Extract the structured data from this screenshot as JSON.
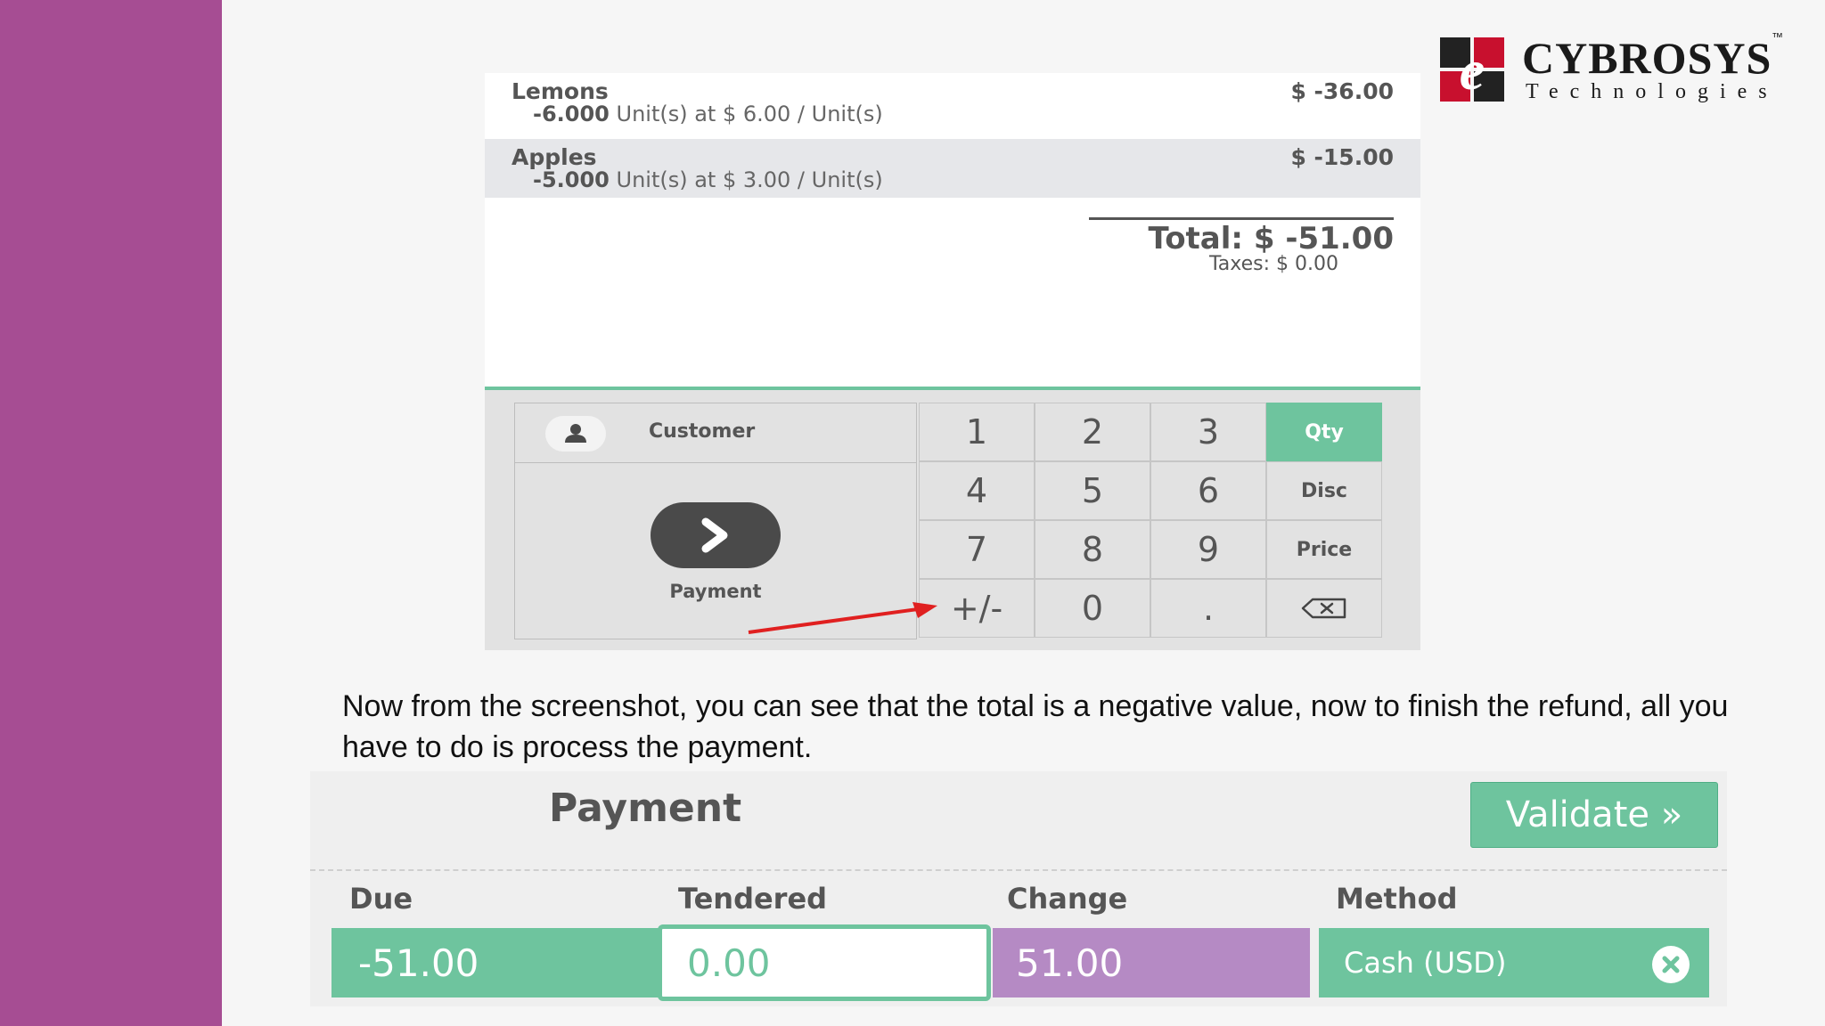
{
  "logo": {
    "name": "CYBROSYS",
    "tm": "™",
    "sub": "Technologies"
  },
  "order": {
    "lines": [
      {
        "product": "Lemons",
        "qty": "-6.000",
        "detail": " Unit(s) at $ 6.00 / Unit(s)",
        "price": "$ -36.00"
      },
      {
        "product": "Apples",
        "qty": "-5.000",
        "detail": " Unit(s) at $ 3.00 / Unit(s)",
        "price": "$ -15.00"
      }
    ],
    "total": "Total: $ -51.00",
    "taxes": "Taxes: $ 0.00"
  },
  "controls": {
    "customer_label": "Customer",
    "payment_label": "Payment",
    "numpad": [
      "1",
      "2",
      "3",
      "Qty",
      "4",
      "5",
      "6",
      "Disc",
      "7",
      "8",
      "9",
      "Price",
      "+/-",
      "0",
      "."
    ],
    "active_mode": "Qty"
  },
  "paragraph": "Now from the screenshot, you can see that the total is a negative value, now to finish the refund, all you have to do is process the payment.",
  "payment_screen": {
    "title": "Payment",
    "validate_label": "Validate »",
    "headers": {
      "due": "Due",
      "tendered": "Tendered",
      "change": "Change",
      "method": "Method"
    },
    "values": {
      "due": "-51.00",
      "tendered": "0.00",
      "change": "51.00",
      "method": "Cash (USD)"
    }
  },
  "colors": {
    "sidebar": "#a64d93",
    "accent_green": "#6ec49e",
    "change_purple": "#b58ac4",
    "arrow_red": "#e02020"
  }
}
